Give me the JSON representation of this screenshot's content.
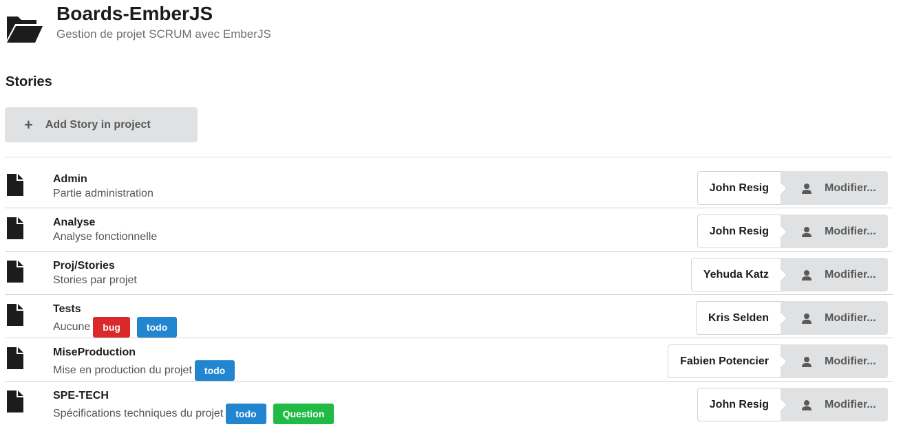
{
  "header": {
    "title": "Boards-EmberJS",
    "subtitle": "Gestion de projet SCRUM avec EmberJS"
  },
  "section": {
    "title": "Stories"
  },
  "add_button": {
    "icon": "plus-icon",
    "label": "Add Story in project"
  },
  "modify_label": "Modifier...",
  "colors": {
    "bug": "#db2828",
    "todo": "#2185d0",
    "question": "#21ba45"
  },
  "stories": [
    {
      "name": "Admin",
      "description": "Partie administration",
      "tags": [],
      "assignee": "John Resig"
    },
    {
      "name": "Analyse",
      "description": "Analyse fonctionnelle",
      "tags": [],
      "assignee": "John Resig"
    },
    {
      "name": "Proj/Stories",
      "description": "Stories par projet",
      "tags": [],
      "assignee": "Yehuda Katz"
    },
    {
      "name": "Tests",
      "description": "Aucune",
      "tags": [
        {
          "label": "bug",
          "color": "#db2828"
        },
        {
          "label": "todo",
          "color": "#2185d0"
        }
      ],
      "assignee": "Kris Selden"
    },
    {
      "name": "MiseProduction",
      "description": "Mise en production du projet",
      "tags": [
        {
          "label": "todo",
          "color": "#2185d0"
        }
      ],
      "assignee": "Fabien Potencier"
    },
    {
      "name": "SPE-TECH",
      "description": "Spécifications techniques du projet",
      "tags": [
        {
          "label": "todo",
          "color": "#2185d0"
        },
        {
          "label": "Question",
          "color": "#21ba45"
        }
      ],
      "assignee": "John Resig"
    }
  ]
}
